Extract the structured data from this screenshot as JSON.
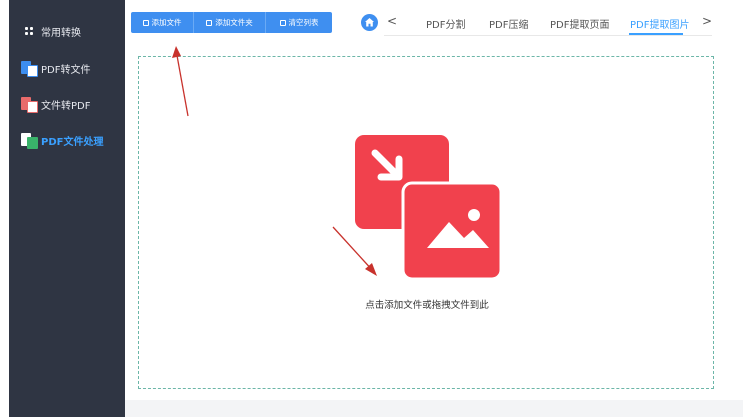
{
  "sidebar": {
    "items": [
      {
        "label": "常用转换",
        "icon": "grid-circle-icon"
      },
      {
        "label": "PDF转文件",
        "icon": "pdf-to-file-icon"
      },
      {
        "label": "文件转PDF",
        "icon": "file-to-pdf-icon"
      },
      {
        "label": "PDF文件处理",
        "icon": "pdf-process-icon",
        "active": true
      }
    ]
  },
  "toolbar": {
    "add_file": "添加文件",
    "add_folder": "添加文件夹",
    "clear_list": "清空列表"
  },
  "tabs": {
    "items": [
      "PDF分割",
      "PDF压缩",
      "PDF提取页面",
      "PDF提取图片"
    ],
    "active": "PDF提取图片",
    "prev_arrow": "<",
    "next_arrow": ">"
  },
  "dropzone": {
    "hint": "点击添加文件或拖拽文件到此"
  },
  "colors": {
    "sidebar_bg": "#2f3543",
    "accent": "#3f8ff0",
    "active_text": "#3aa0ff",
    "illustration_red": "#f1414d",
    "annotation_arrow": "#c8322c"
  }
}
